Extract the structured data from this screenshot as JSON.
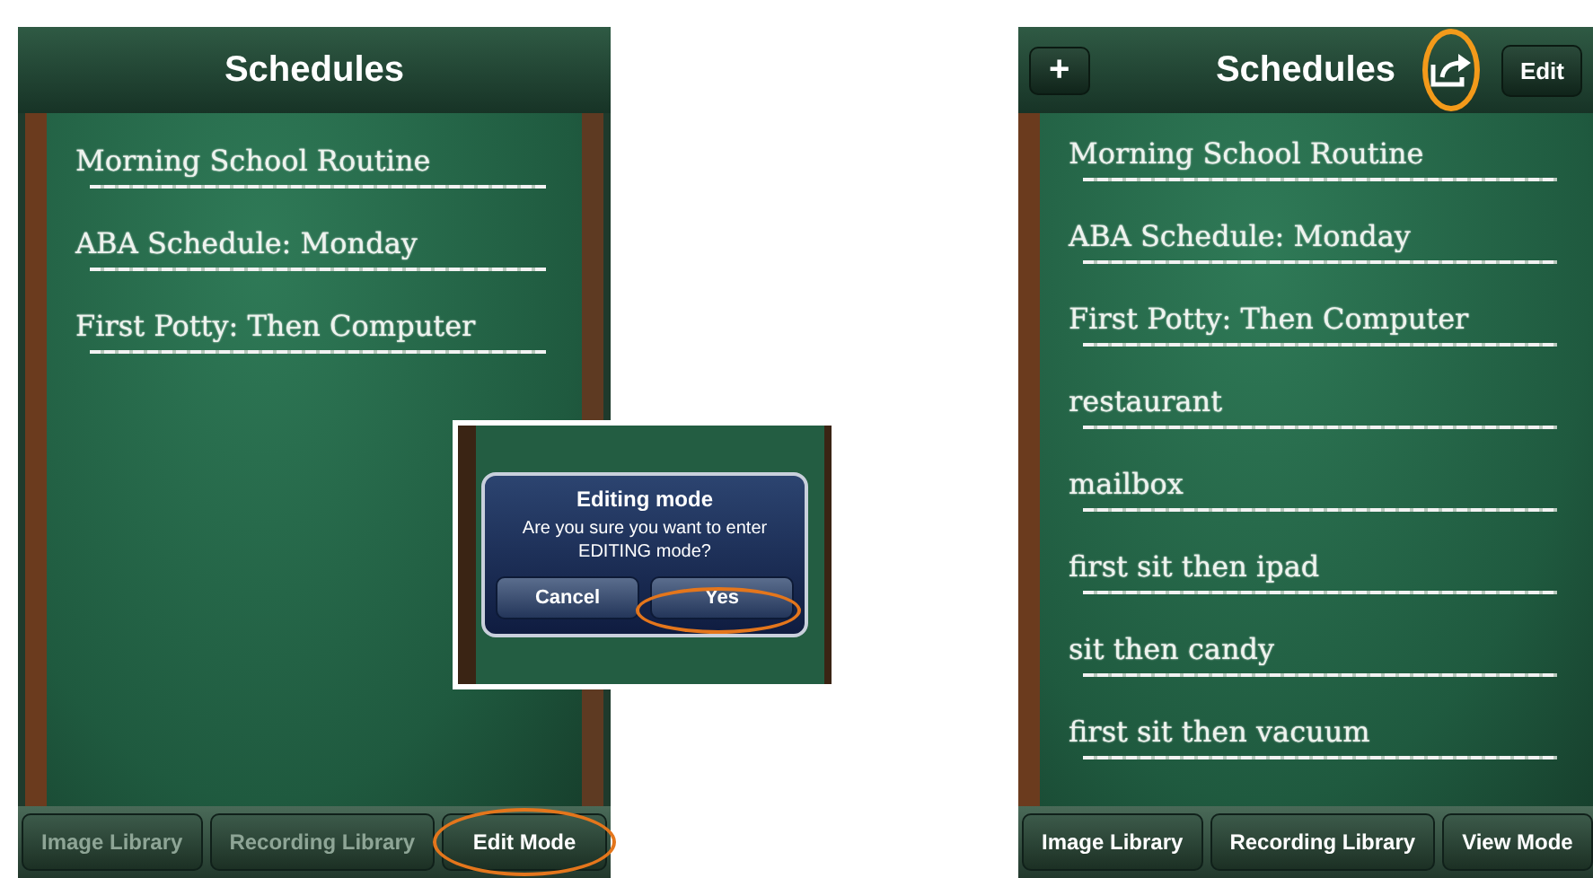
{
  "screens": [
    {
      "title": "Schedules",
      "schedules": [
        "Morning School Routine",
        "ABA Schedule: Monday",
        "First Potty: Then Computer"
      ],
      "toolbar": [
        {
          "label": "Image Library",
          "disabled": true,
          "highlighted": false
        },
        {
          "label": "Recording Library",
          "disabled": true,
          "highlighted": false
        },
        {
          "label": "Edit Mode",
          "disabled": false,
          "highlighted": true
        }
      ]
    },
    {
      "title": "Schedules",
      "nav_left": [
        {
          "kind": "text",
          "label": "+",
          "highlighted": false
        }
      ],
      "nav_right": [
        {
          "kind": "share",
          "highlighted": true
        },
        {
          "kind": "text",
          "label": "Edit",
          "highlighted": false
        }
      ],
      "schedules": [
        "Morning School Routine",
        "ABA Schedule: Monday",
        "First Potty: Then Computer",
        "restaurant",
        "mailbox",
        "first sit then ipad",
        "sit then candy",
        "first sit then vacuum"
      ],
      "toolbar": [
        {
          "label": "Image Library",
          "disabled": false,
          "highlighted": false
        },
        {
          "label": "Recording Library",
          "disabled": false,
          "highlighted": false
        },
        {
          "label": "View Mode",
          "disabled": false,
          "highlighted": false
        }
      ]
    }
  ],
  "dialog": {
    "title": "Editing mode",
    "message": "Are you sure you want to enter EDITING mode?",
    "buttons": [
      {
        "label": "Cancel",
        "highlighted": false
      },
      {
        "label": "Yes",
        "highlighted": true
      }
    ]
  }
}
